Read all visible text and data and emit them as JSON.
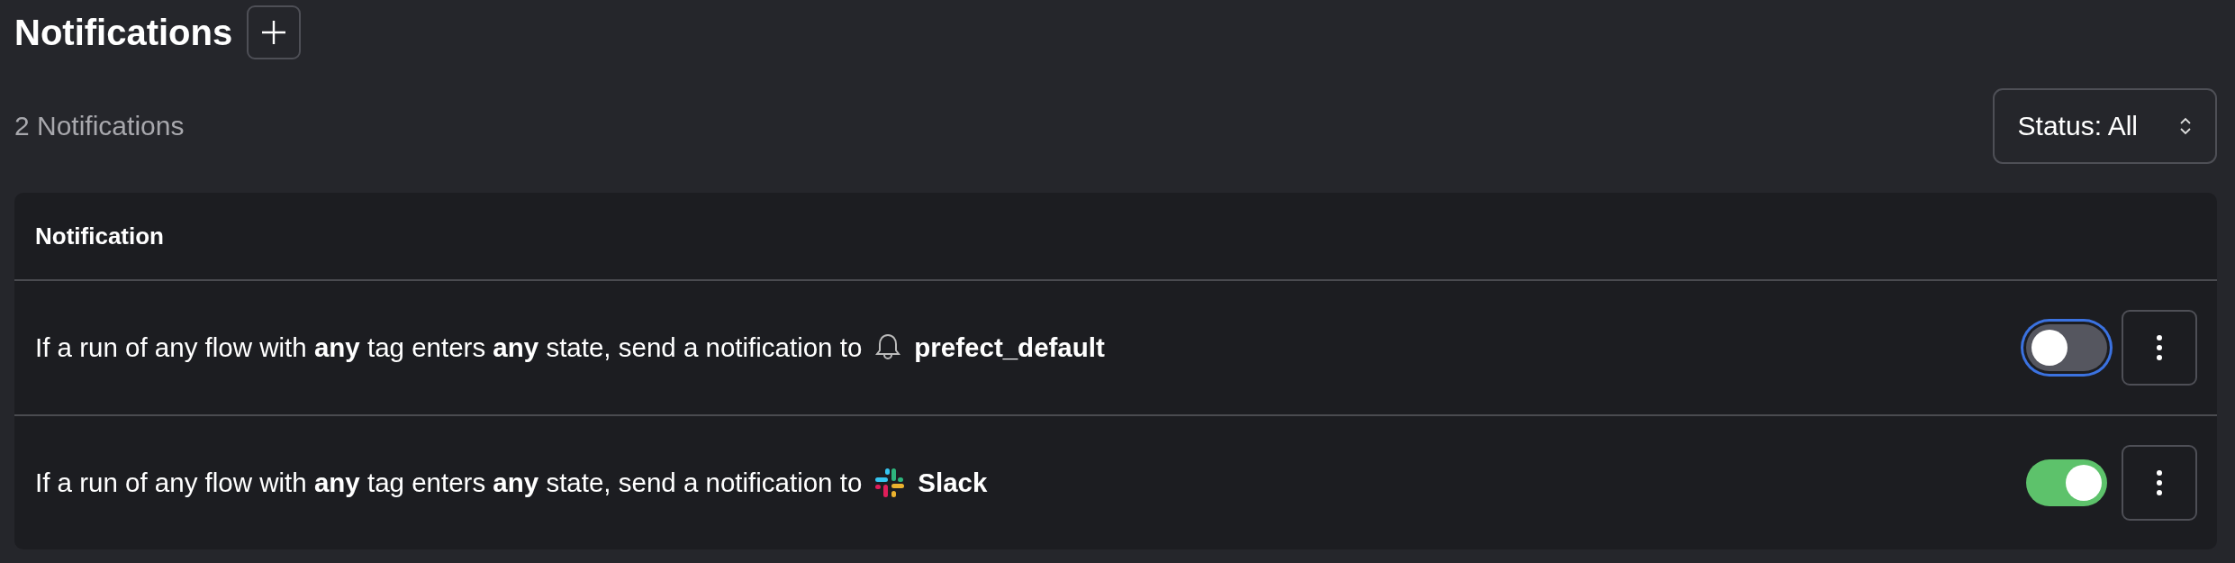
{
  "header": {
    "title": "Notifications",
    "count": "2 Notifications",
    "status_filter": "Status: All"
  },
  "table": {
    "column": "Notification",
    "rows": [
      {
        "text": "If a run of any flow with **any** tag enters **any** state, send a notification to",
        "channel": {
          "kind": "bell",
          "name": "prefect_default"
        },
        "on": false,
        "focused": true
      },
      {
        "text": "If a run of any flow with **any** tag enters **any** state, send a notification to",
        "channel": {
          "kind": "slack",
          "name": "Slack"
        },
        "on": true,
        "focused": false
      }
    ]
  }
}
